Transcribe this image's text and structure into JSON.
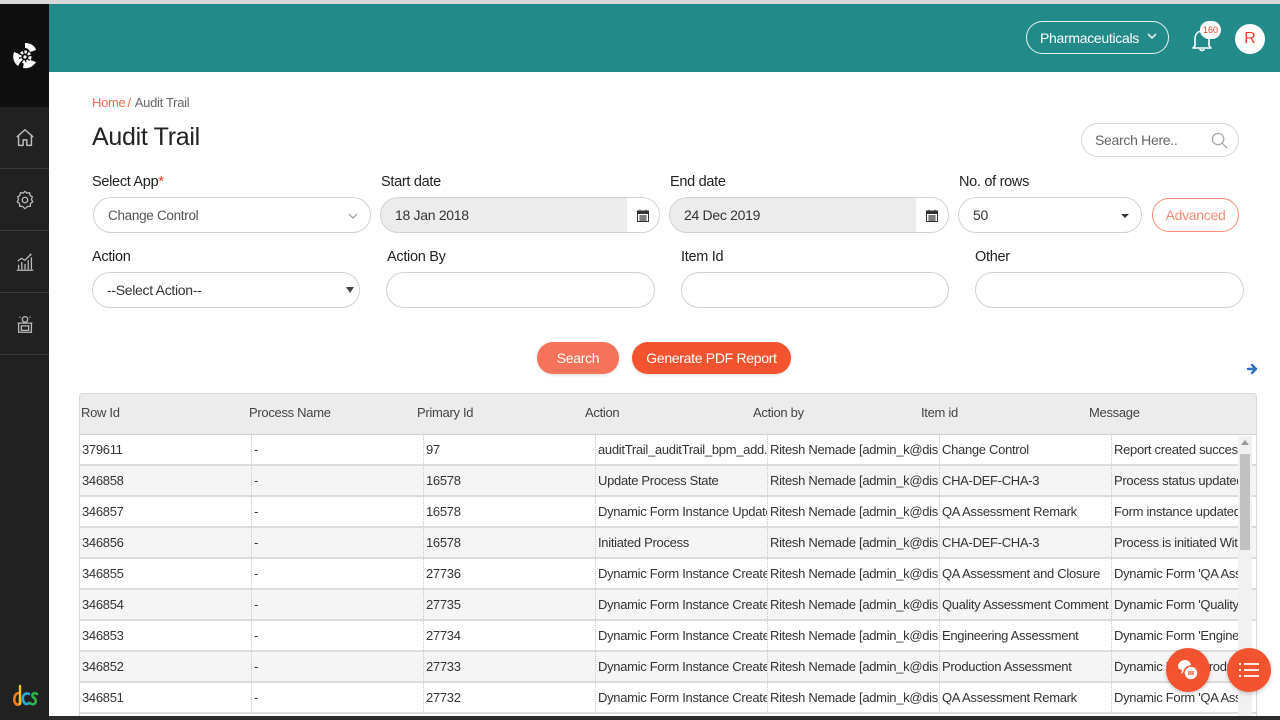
{
  "header": {
    "org_selector": "Pharmaceuticals",
    "notification_count": "160",
    "avatar_initial": "R"
  },
  "sidebar": {
    "items": [
      {
        "name": "home",
        "icon": "home-icon"
      },
      {
        "name": "settings",
        "icon": "gear-icon"
      },
      {
        "name": "analytics",
        "icon": "chart-icon"
      },
      {
        "name": "admin",
        "icon": "desk-user-icon"
      }
    ]
  },
  "breadcrumb": {
    "home": "Home",
    "separator": "/",
    "current": "Audit Trail"
  },
  "page": {
    "title": "Audit Trail",
    "search_placeholder": "Search Here.."
  },
  "filters": {
    "select_app": {
      "label": "Select App",
      "required_mark": "*",
      "value": "Change Control"
    },
    "start_date": {
      "label": "Start date",
      "value": "18 Jan 2018"
    },
    "end_date": {
      "label": "End date",
      "value": "24 Dec 2019"
    },
    "rows": {
      "label": "No. of rows",
      "value": "50"
    },
    "advanced_label": "Advanced",
    "action": {
      "label": "Action",
      "value": "--Select Action--"
    },
    "action_by": {
      "label": "Action By",
      "value": ""
    },
    "item_id": {
      "label": "Item Id",
      "value": ""
    },
    "other": {
      "label": "Other",
      "value": ""
    }
  },
  "buttons": {
    "search": "Search",
    "pdf": "Generate PDF Report"
  },
  "colors": {
    "header_teal": "#238a8a",
    "accent_orange": "#f4532f",
    "sidebar_dark": "#212121"
  },
  "table": {
    "columns": [
      "Row Id",
      "Process Name",
      "Primary Id",
      "Action",
      "Action by",
      "Item id",
      "Message"
    ],
    "rows": [
      [
        "379611",
        "-",
        "97",
        "auditTrail_auditTrail_bpm_add...",
        "Ritesh Nemade [admin_k@dis...",
        "Change Control",
        "Report created successfu"
      ],
      [
        "346858",
        "-",
        "16578",
        "Update Process State",
        "Ritesh Nemade [admin_k@dis...",
        "CHA-DEF-CHA-3",
        "Process status updated s"
      ],
      [
        "346857",
        "-",
        "16578",
        "Dynamic Form Instance Updated",
        "Ritesh Nemade [admin_k@dis...",
        "QA Assessment Remark",
        "Form instance updated:"
      ],
      [
        "346856",
        "-",
        "16578",
        "Initiated Process",
        "Ritesh Nemade [admin_k@dis...",
        "CHA-DEF-CHA-3",
        "Process is initiated With"
      ],
      [
        "346855",
        "-",
        "27736",
        "Dynamic Form Instance Created",
        "Ritesh Nemade [admin_k@dis...",
        "QA Assessment and Closure",
        "Dynamic Form 'QA Asses"
      ],
      [
        "346854",
        "-",
        "27735",
        "Dynamic Form Instance Created",
        "Ritesh Nemade [admin_k@dis...",
        "Quality Assessment Comment",
        "Dynamic Form 'Quality A"
      ],
      [
        "346853",
        "-",
        "27734",
        "Dynamic Form Instance Created",
        "Ritesh Nemade [admin_k@dis...",
        "Engineering Assessment",
        "Dynamic Form 'Engineer"
      ],
      [
        "346852",
        "-",
        "27733",
        "Dynamic Form Instance Created",
        "Ritesh Nemade [admin_k@dis...",
        "Production Assessment",
        "Dynamic Form 'Producti"
      ],
      [
        "346851",
        "-",
        "27732",
        "Dynamic Form Instance Created",
        "Ritesh Nemade [admin_k@dis...",
        "QA Assessment Remark",
        "Dynamic Form 'QA Asses"
      ]
    ]
  }
}
